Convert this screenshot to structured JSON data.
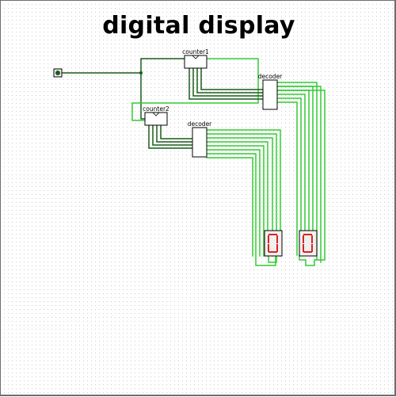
{
  "title": "digital display",
  "components": {
    "counter1": {
      "label": "counter1"
    },
    "counter2": {
      "label": "counter2"
    },
    "decoder_top": {
      "label": "decoder"
    },
    "decoder_bottom": {
      "label": "decoder"
    },
    "display_left": {
      "digit": "0"
    },
    "display_right": {
      "digit": "0"
    }
  },
  "colors": {
    "wire_dark": "#1a5c1a",
    "wire_light": "#33cc33",
    "segment": "#dd2222",
    "component_border": "#000000"
  },
  "icons": {
    "clock": "clock-source-icon"
  }
}
